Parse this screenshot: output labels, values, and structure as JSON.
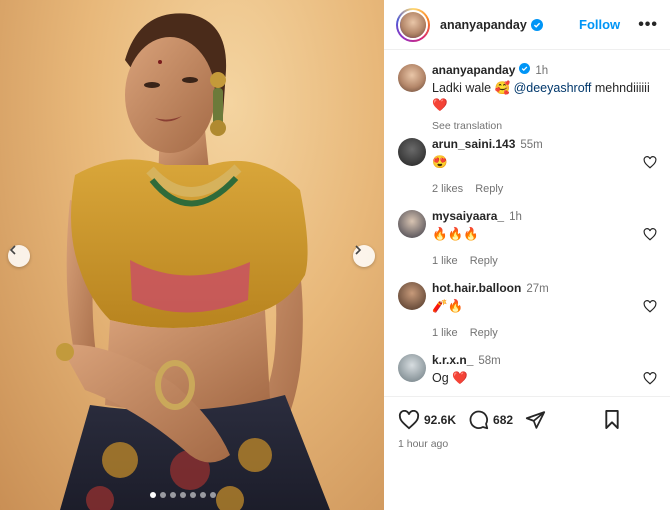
{
  "post": {
    "author": "ananyapanday",
    "follow_label": "Follow",
    "more_label": "•••",
    "likes_count": "92.6K",
    "comments_count": "682",
    "timestamp": "1 hour ago",
    "carousel": {
      "dot_count": 7,
      "active_index": 0
    }
  },
  "caption": {
    "user": "ananyapanday",
    "time": "1h",
    "text_before": "Ladki wale 🥰 ",
    "mention": "@deeyashroff",
    "text_after": " mehndiiiiii",
    "emoji_line": "❤️",
    "see_translation": "See translation"
  },
  "comments": [
    {
      "user": "arun_saini.143",
      "time": "55m",
      "text": "😍",
      "likes": "2 likes",
      "reply": "Reply"
    },
    {
      "user": "mysaiyaara_",
      "time": "1h",
      "text": "🔥🔥🔥",
      "likes": "1 like",
      "reply": "Reply"
    },
    {
      "user": "hot.hair.balloon",
      "time": "27m",
      "text": "🧨🔥",
      "likes": "1 like",
      "reply": "Reply"
    },
    {
      "user": "k.r.x.n_",
      "time": "58m",
      "text": "Og ❤️",
      "likes": "",
      "reply": ""
    }
  ],
  "colors": {
    "accent": "#0095f6",
    "verified": "#0095f6",
    "mention": "#00376b",
    "secondary_text": "#737373"
  },
  "icons": {
    "verified": "verified-badge-icon",
    "like": "heart-icon",
    "comment": "comment-bubble-icon",
    "share": "paper-plane-icon",
    "save": "bookmark-icon",
    "prev": "chevron-left-icon",
    "next": "chevron-right-icon"
  }
}
